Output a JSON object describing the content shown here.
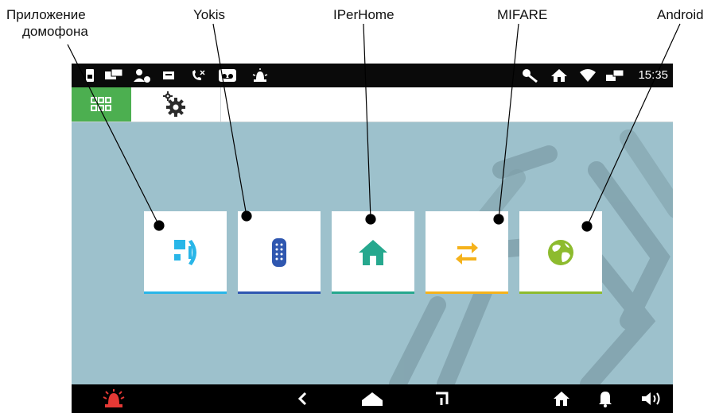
{
  "callouts": {
    "intercom_line1": "Приложение",
    "intercom_line2": "домофона",
    "yokis": "Yokis",
    "iperhome": "IPerHome",
    "mifare": "MIFARE",
    "android": "Android"
  },
  "statusbar": {
    "time": "15:35",
    "left_icons": [
      "sim-icon",
      "chat-icon",
      "user-add-icon",
      "message-icon",
      "missed-call-icon",
      "voicemail-icon",
      "alarm-icon"
    ],
    "right_icons": [
      "key-icon",
      "home-icon",
      "wifi-icon",
      "network-icon"
    ]
  },
  "toolbar": {
    "tabs": [
      "apps-grid-icon",
      "settings-gears-icon"
    ],
    "active_color": "#4caf50"
  },
  "tiles": [
    {
      "name": "intercom",
      "icon": "intercom-app-icon",
      "color": "#29b6e8"
    },
    {
      "name": "yokis",
      "icon": "remote-control-icon",
      "color": "#2f57b0"
    },
    {
      "name": "iperhome",
      "icon": "home-icon",
      "color": "#26a88e"
    },
    {
      "name": "mifare",
      "icon": "exchange-arrows-icon",
      "color": "#f5b21b"
    },
    {
      "name": "android",
      "icon": "globe-icon",
      "color": "#8dbb2e"
    }
  ],
  "navbar": {
    "icons": [
      "alarm-icon",
      "back-icon",
      "home-icon",
      "recent-apps-icon",
      "house-icon",
      "bell-icon",
      "volume-icon"
    ],
    "alarm_color": "#e53935"
  },
  "colors": {
    "screen_bg": "#9dc1cc",
    "decor": "#7e9ea8"
  }
}
